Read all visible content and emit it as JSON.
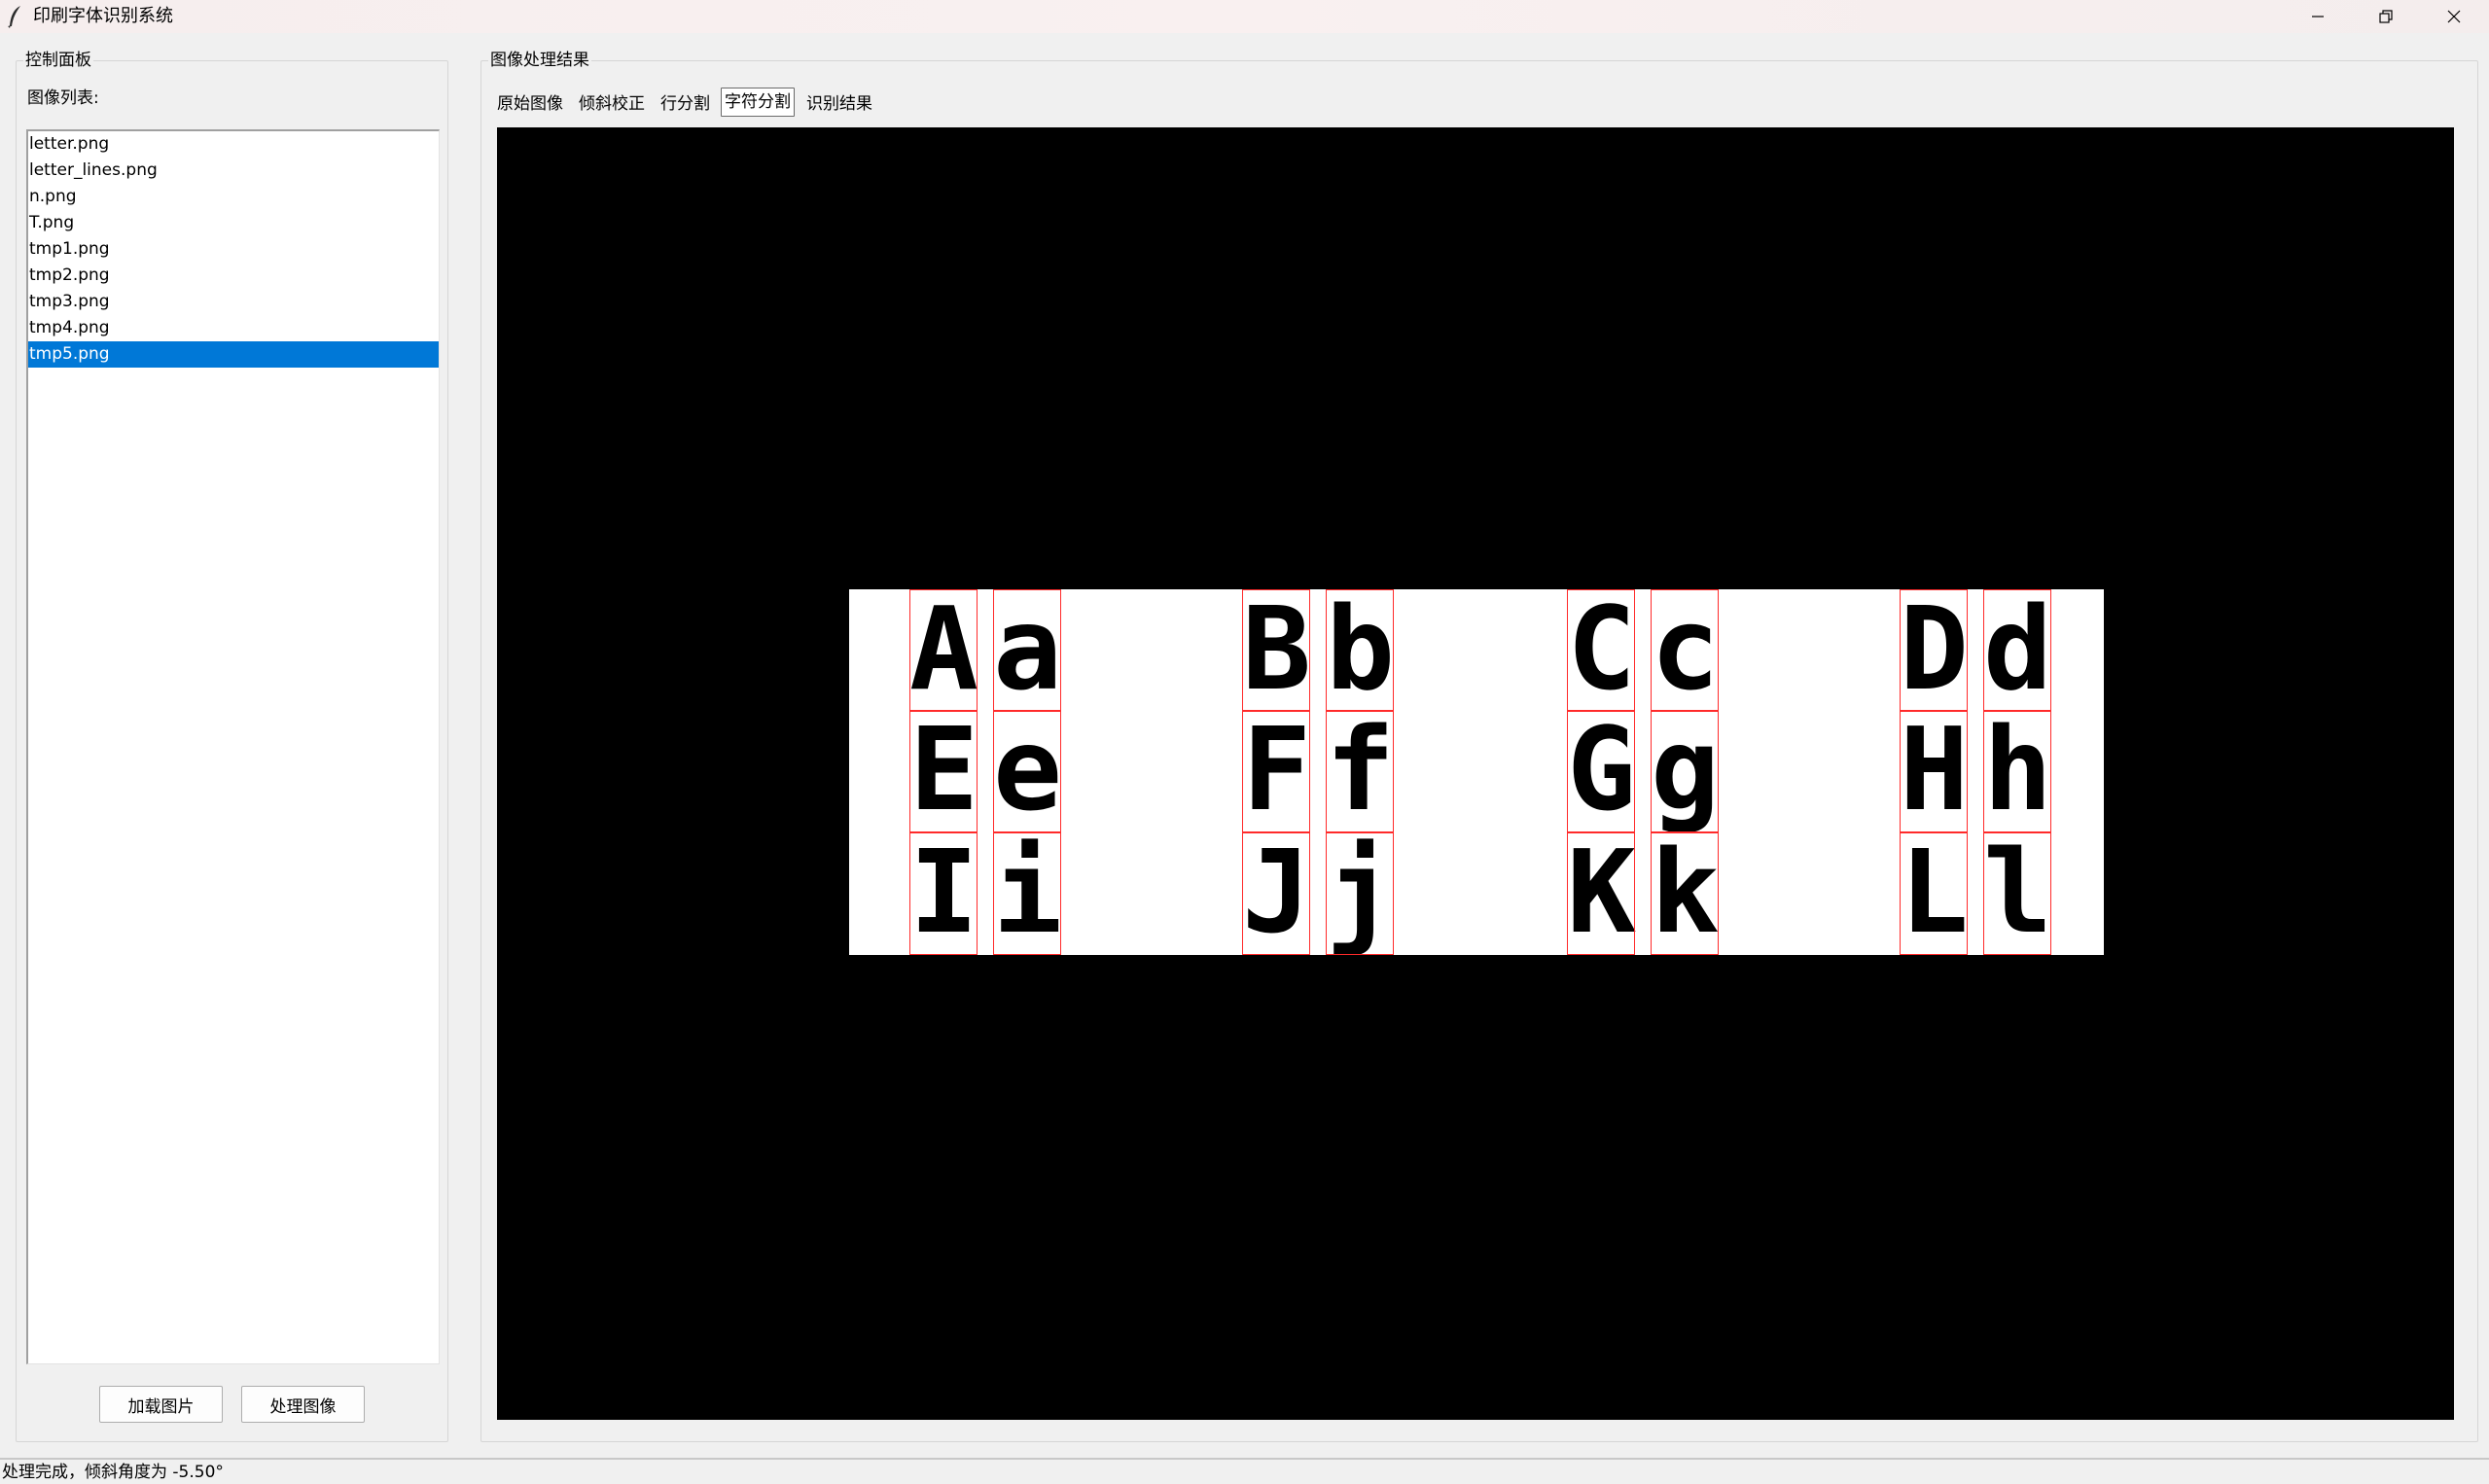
{
  "window": {
    "title": "印刷字体识别系统",
    "controls": [
      "minimize",
      "restore",
      "close"
    ]
  },
  "control_panel": {
    "title": "控制面板",
    "list_label": "图像列表:",
    "files": [
      "letter.png",
      "letter_lines.png",
      "n.png",
      "T.png",
      "tmp1.png",
      "tmp2.png",
      "tmp3.png",
      "tmp4.png",
      "tmp5.png"
    ],
    "selected_file": "tmp5.png",
    "load_button": "加载图片",
    "process_button": "处理图像"
  },
  "results_panel": {
    "title": "图像处理结果",
    "tabs": [
      "原始图像",
      "倾斜校正",
      "行分割",
      "字符分割",
      "识别结果"
    ],
    "active_tab": "字符分割",
    "image": {
      "rows": [
        [
          "A",
          "a",
          "B",
          "b",
          "C",
          "c",
          "D",
          "d"
        ],
        [
          "E",
          "e",
          "F",
          "f",
          "G",
          "g",
          "H",
          "h"
        ],
        [
          "I",
          "i",
          "J",
          "j",
          "K",
          "k",
          "L",
          "l"
        ]
      ],
      "box_color": "#ff2a2a",
      "background": "#000000"
    }
  },
  "status": {
    "text": "处理完成，倾斜角度为 -5.50°"
  },
  "colors": {
    "selection": "#0078d7",
    "window_bg": "#f0f0f0"
  }
}
